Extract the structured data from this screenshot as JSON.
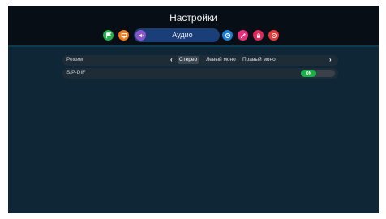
{
  "header": {
    "title": "Настройки",
    "active_tab_label": "Аудио"
  },
  "tabs": [
    {
      "icon": "flag-icon",
      "color": "#25b04a"
    },
    {
      "icon": "screen-icon",
      "color": "#f07a1c"
    },
    {
      "icon": "speaker-icon",
      "color": "#8a55c8",
      "active": true
    },
    {
      "icon": "clock-icon",
      "color": "#1f7fd0"
    },
    {
      "icon": "wrench-icon",
      "color": "#e52f7a"
    },
    {
      "icon": "lock-icon",
      "color": "#e2275a"
    },
    {
      "icon": "reset-icon",
      "color": "#e23a3a"
    }
  ],
  "settings": {
    "mode": {
      "label": "Режим",
      "options": [
        "Стерео",
        "Левый моно",
        "Правый моно"
      ],
      "selected": "Стерео"
    },
    "spdif": {
      "label": "S/P-DIF",
      "toggle_state": "ON"
    }
  },
  "colors": {
    "background": "#0e2636",
    "header_bg": "#070e16",
    "active_pill": "#1a3e78",
    "toggle_on": "#19b04a"
  }
}
